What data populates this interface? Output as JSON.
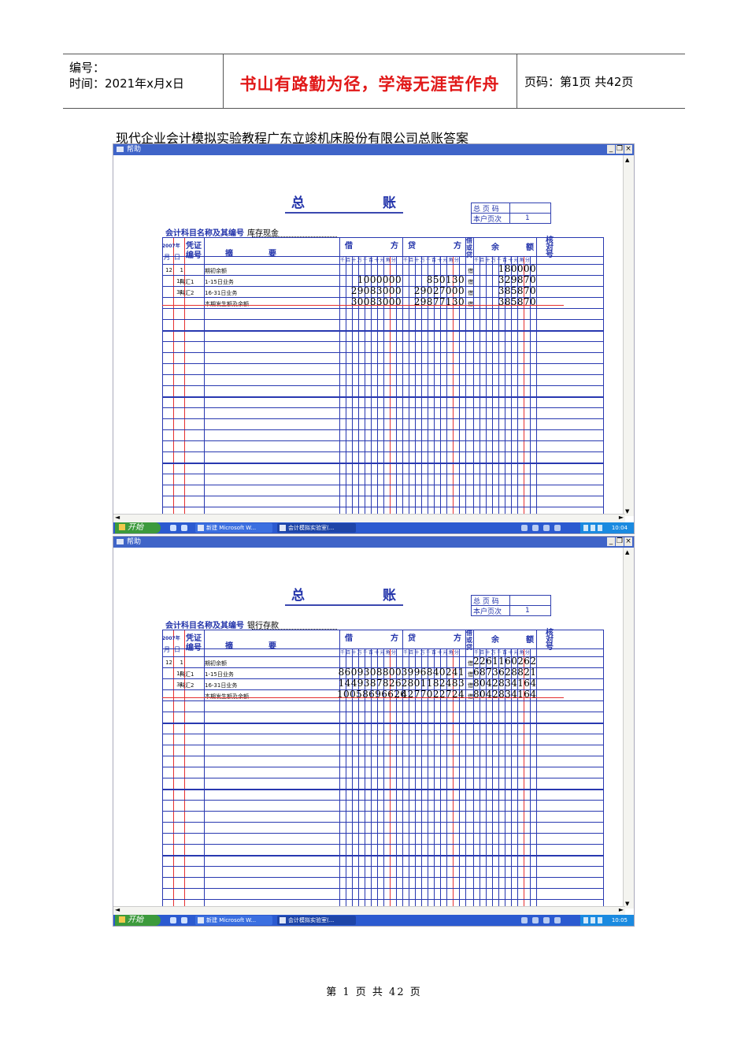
{
  "header": {
    "number_label": "编号：",
    "date_label": "时间：2021年x月x日",
    "motto": "书山有路勤为径，学海无涯苦作舟",
    "page_info": "页码：第1页  共42页"
  },
  "doc_title": "现代企业会计模拟实验教程广东立竣机床股份有限公司总账答案",
  "window": {
    "title": "帮助",
    "start": "开始",
    "task1": "新建 Microsoft W...",
    "task2": "会计模拟实验室(...",
    "scroll_up": "▲",
    "scroll_down": "▼",
    "scroll_left": "◄",
    "scroll_right": "►",
    "minimize": "_",
    "restore": "❐",
    "close": "×"
  },
  "ledger_labels": {
    "title_left": "总",
    "title_right": "账",
    "page_code": "总 页 码",
    "account_page": "本户页次",
    "account_name_label": "会计科目名称及其编号",
    "year": "2007年",
    "month": "月",
    "day": "日",
    "voucher1": "凭证",
    "voucher2": "编号",
    "summary1": "摘",
    "summary2": "要",
    "debit1": "借",
    "debit2": "方",
    "credit1": "贷",
    "credit2": "方",
    "dir": "借或贷",
    "balance1": "余",
    "balance2": "额",
    "check": "核对号",
    "digits": "千百十万千百十元角分"
  },
  "screens": [
    {
      "clock": "10:04",
      "account_page_value": "1",
      "account_name": "库存现金",
      "rows": [
        {
          "month": "12",
          "day": "1",
          "voucher": "",
          "summary": "期初余额",
          "debit": "",
          "credit": "",
          "dir": "借",
          "balance": "180000"
        },
        {
          "month": "",
          "day": "15",
          "voucher": "科汇1",
          "summary": "1-15日业务",
          "debit": "1000000",
          "credit": "850130",
          "dir": "借",
          "balance": "329870"
        },
        {
          "month": "",
          "day": "31",
          "voucher": "科汇2",
          "summary": "16-31日业务",
          "debit": "29083000",
          "credit": "29027000",
          "dir": "借",
          "balance": "385870"
        },
        {
          "month": "",
          "day": "",
          "voucher": "",
          "summary": "本期发生额及余额",
          "debit": "30083000",
          "credit": "29877130",
          "dir": "借",
          "balance": "385870"
        }
      ]
    },
    {
      "clock": "10:05",
      "account_page_value": "1",
      "account_name": "银行存款",
      "rows": [
        {
          "month": "12",
          "day": "1",
          "voucher": "",
          "summary": "期初余额",
          "debit": "",
          "credit": "",
          "dir": "借",
          "balance": "2261160262"
        },
        {
          "month": "",
          "day": "15",
          "voucher": "科汇1",
          "summary": "1-15日业务",
          "debit": "8609308800",
          "credit": "3996840241",
          "dir": "借",
          "balance": "6873628821"
        },
        {
          "month": "",
          "day": "31",
          "voucher": "科汇2",
          "summary": "16-31日业务",
          "debit": "1449387826",
          "credit": "2801182483",
          "dir": "借",
          "balance": "8042834164"
        },
        {
          "month": "",
          "day": "",
          "voucher": "",
          "summary": "本期发生额及余额",
          "debit": "10058696626",
          "credit": "4277022724",
          "dir": "借",
          "balance": "8042834164"
        }
      ]
    }
  ],
  "footer": "第 1 页 共 42 页"
}
